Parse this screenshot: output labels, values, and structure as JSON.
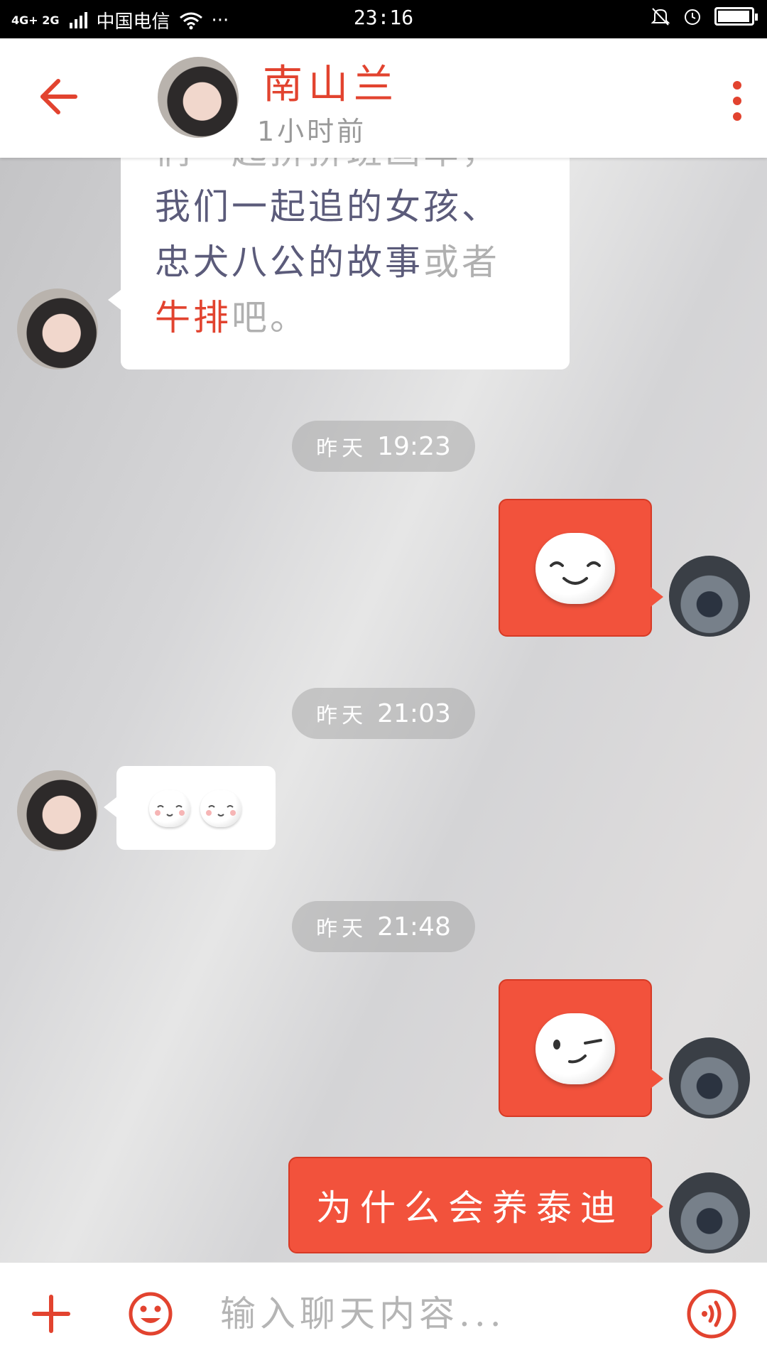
{
  "status_bar": {
    "network": "4G+ 2G",
    "carrier": "中国电信",
    "more": "···",
    "time": "23:16",
    "battery_level": 0.95
  },
  "header": {
    "contact_name": "南山兰",
    "last_seen": "1小时前"
  },
  "messages": {
    "first_text_line1": "们一起拼拼班画车，",
    "first_text_line2": "我们一起追的女孩、",
    "first_text_line3_a": "忠犬八公的故事",
    "first_text_line3_b": "或者",
    "first_text_line4_a": "牛排",
    "first_text_line4_b": "吧。",
    "time1_day": "昨天",
    "time1_clock": "19:23",
    "out1_emoji": "smile-emoji",
    "time2_day": "昨天",
    "time2_clock": "21:03",
    "in2_emoji": "blush-emoji",
    "time3_day": "昨天",
    "time3_clock": "21:48",
    "out2_emoji": "wink-emoji",
    "out3_text": "为什么会养泰迪"
  },
  "composer": {
    "placeholder": "输入聊天内容..."
  },
  "colors": {
    "accent": "#e2432f",
    "bubble_out": "#f2523c"
  }
}
